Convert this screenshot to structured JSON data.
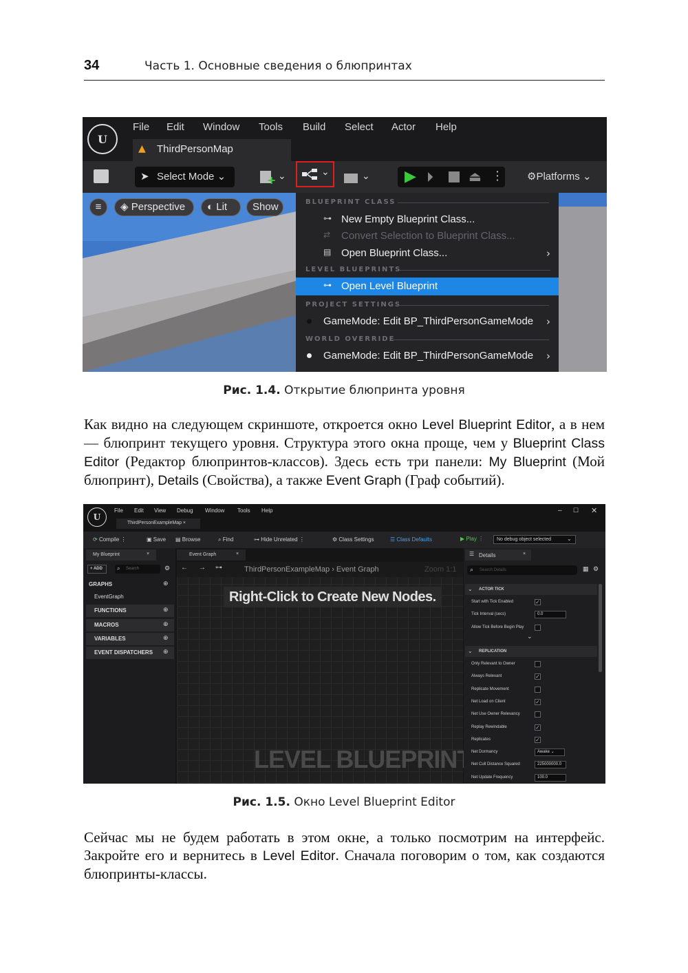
{
  "header": {
    "page_number": "34",
    "running_title": "Часть 1. Основные сведения о блюпринтах"
  },
  "figure1": {
    "menu": [
      "File",
      "Edit",
      "Window",
      "Tools",
      "Build",
      "Select",
      "Actor",
      "Help"
    ],
    "map_tab": "ThirdPersonMap",
    "select_mode": "Select Mode",
    "platforms": "Platforms",
    "viewport_buttons": {
      "perspective": "Perspective",
      "lit": "Lit",
      "show": "Show"
    },
    "dropdown": {
      "section_blueprint_class": "BLUEPRINT CLASS",
      "new_empty": "New Empty Blueprint Class...",
      "convert": "Convert Selection to Blueprint Class...",
      "open_class": "Open Blueprint Class...",
      "section_level": "LEVEL BLUEPRINTS",
      "open_level": "Open Level Blueprint",
      "section_project": "PROJECT SETTINGS",
      "gamemode_project": "GameMode: Edit BP_ThirdPersonGameMode",
      "section_world": "WORLD OVERRIDE",
      "gamemode_world": "GameMode: Edit BP_ThirdPersonGameMode"
    },
    "colors": {
      "highlight": "#1e87e6",
      "red_outline": "#e02020",
      "play_green": "#3cc83c"
    }
  },
  "caption1": {
    "label": "Рис. 1.4.",
    "text": "Открытие блюпринта уровня"
  },
  "paragraph1": {
    "t1": "Как видно на следующем скриншоте, откроется окно ",
    "s1": "Level Blueprint Editor",
    "t2": ", а в нем — блюпринт текущего уровня. Структура этого окна проще, чем у ",
    "s2": "Blueprint Class Editor",
    "t3": " (Редактор блюпринтов-классов). Здесь есть три панели: ",
    "s3": "My Blueprint",
    "t4": " (Мой блюпринт), ",
    "s4": "Details",
    "t5": " (Свойства), а также ",
    "s5": "Event Graph",
    "t6": " (Граф событий)."
  },
  "figure2": {
    "menu": [
      "File",
      "Edit",
      "View",
      "Debug",
      "Window",
      "Tools",
      "Help"
    ],
    "tab": "ThirdPersonExampleMap ×",
    "toolbar": {
      "compile": "Compile",
      "save": "Save",
      "browse": "Browse",
      "find": "Find",
      "hide_unrelated": "Hide Unrelated",
      "class_settings": "Class Settings",
      "class_defaults": "Class Defaults",
      "play": "Play",
      "debug": "No debug object selected"
    },
    "my_blueprint": {
      "tab": "My Blueprint",
      "add": "+ ADD",
      "search": "Search",
      "graphs": "GRAPHS",
      "event_graph": "EventGraph",
      "functions": "FUNCTIONS",
      "macros": "MACROS",
      "variables": "VARIABLES",
      "event_dispatchers": "EVENT DISPATCHERS"
    },
    "graph": {
      "tab": "Event Graph",
      "breadcrumb_map": "ThirdPersonExampleMap",
      "breadcrumb_graph": "Event Graph",
      "zoom": "Zoom 1:1",
      "hint": "Right-Click to Create New Nodes.",
      "watermark": "LEVEL BLUEPRINT"
    },
    "details": {
      "tab": "Details",
      "search": "Search Details",
      "section_tick": "ACTOR TICK",
      "start_tick": "Start with Tick Enabled",
      "tick_interval": "Tick Interval (secs)",
      "tick_interval_value": "0.0",
      "allow_tick": "Allow Tick Before Begin Play",
      "section_replication": "REPLICATION",
      "rows": [
        {
          "label": "Only Relevant to Owner",
          "checked": false
        },
        {
          "label": "Always Relevant",
          "checked": true
        },
        {
          "label": "Replicate Movement",
          "checked": false
        },
        {
          "label": "Net Load on Client",
          "checked": true
        },
        {
          "label": "Net Use Owner Relevancy",
          "checked": false
        },
        {
          "label": "Replay Rewindable",
          "checked": true
        },
        {
          "label": "Replicates",
          "checked": true
        }
      ],
      "net_dormancy": "Net Dormancy",
      "net_dormancy_value": "Awake",
      "net_cull": "Net Cull Distance Squared",
      "net_cull_value": "225000000.0",
      "net_update": "Net Update Frequency",
      "net_update_value": "100.0"
    }
  },
  "caption2": {
    "label": "Рис. 1.5.",
    "text": "Окно Level Blueprint Editor"
  },
  "paragraph2": {
    "t1": "Сейчас мы не будем работать в этом окне, а только посмотрим на интерфейс. Закройте его и вернитесь в ",
    "s1": "Level Editor",
    "t2": ". Сначала поговорим о том, как создаются блюпринты-классы."
  }
}
